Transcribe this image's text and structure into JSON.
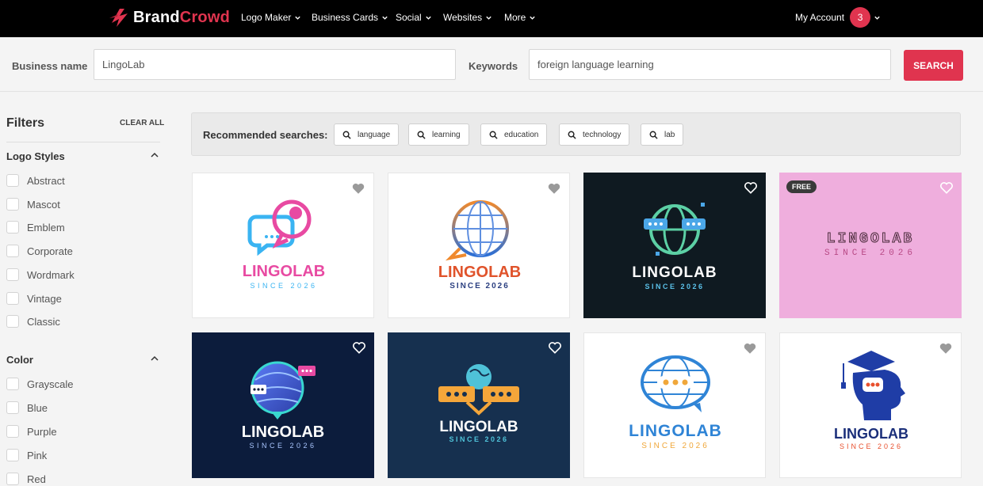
{
  "brand": {
    "name_part1": "Brand",
    "name_part2": "Crowd"
  },
  "nav": {
    "items": [
      "Logo Maker",
      "Business Cards",
      "Social",
      "Websites",
      "More"
    ],
    "account_label": "My Account",
    "account_count": "3"
  },
  "search": {
    "business_label": "Business name",
    "business_value": "LingoLab",
    "keywords_label": "Keywords",
    "keywords_value": "foreign language learning",
    "button_label": "SEARCH"
  },
  "filters": {
    "title": "Filters",
    "clear_label": "CLEAR ALL",
    "sections": [
      {
        "title": "Logo Styles",
        "options": [
          "Abstract",
          "Mascot",
          "Emblem",
          "Corporate",
          "Wordmark",
          "Vintage",
          "Classic"
        ]
      },
      {
        "title": "Color",
        "options": [
          "Grayscale",
          "Blue",
          "Purple",
          "Pink",
          "Red"
        ]
      }
    ]
  },
  "recommended": {
    "label": "Recommended searches:",
    "chips": [
      "language",
      "learning",
      "education",
      "technology",
      "lab"
    ]
  },
  "cards": [
    {
      "name": "LINGOLAB",
      "tagline": "SINCE 2026",
      "free": false
    },
    {
      "name": "LINGOLAB",
      "tagline": "SINCE 2026",
      "free": false
    },
    {
      "name": "LINGOLAB",
      "tagline": "SINCE 2026",
      "free": false
    },
    {
      "name": "LINGOLAB",
      "tagline": "SINCE 2026",
      "free": true,
      "free_label": "FREE"
    },
    {
      "name": "LINGOLAB",
      "tagline": "SINCE 2026",
      "free": false
    },
    {
      "name": "LINGOLAB",
      "tagline": "SINCE 2026",
      "free": false
    },
    {
      "name": "LINGOLAB",
      "tagline": "SINCE 2026",
      "free": false
    },
    {
      "name": "LINGOLAB",
      "tagline": "SINCE 2026",
      "free": false
    }
  ],
  "icons": {
    "logo": "brand-bolt-icon",
    "chevron": "chevron-down-icon",
    "search": "search-icon",
    "heart": "heart-icon",
    "collapse": "chevron-up-icon"
  },
  "colors": {
    "accent": "#e0344f",
    "nav_bg": "#000000",
    "page_bg": "#f4f4f4"
  }
}
